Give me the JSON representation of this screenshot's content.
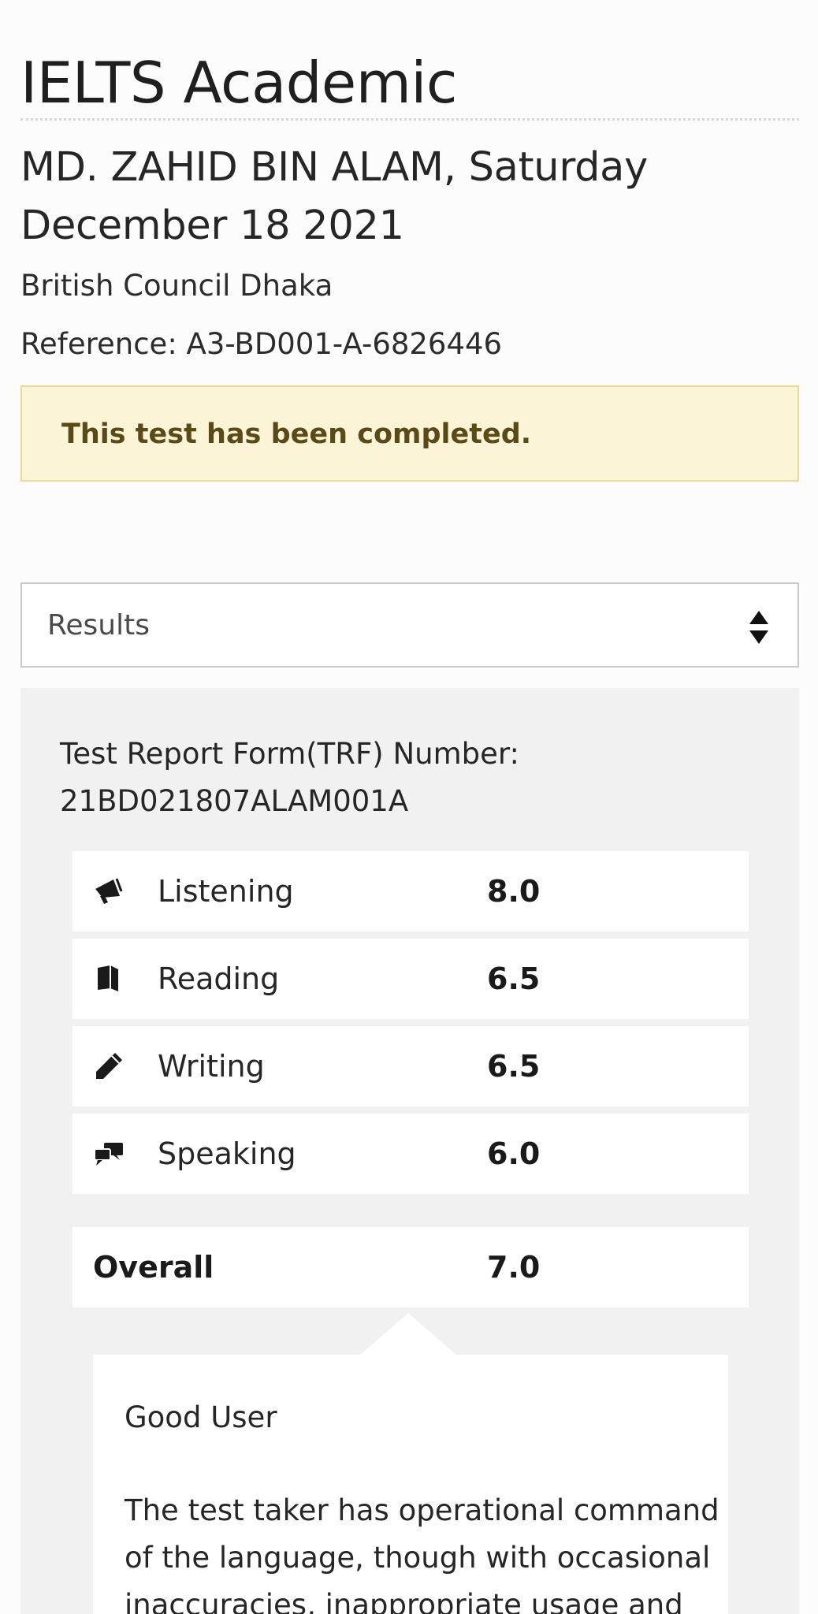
{
  "header": {
    "test_name": "IELTS Academic",
    "candidate_and_date": "MD. ZAHID BIN ALAM, Saturday December 18 2021",
    "test_centre": "British Council Dhaka",
    "reference": "Reference: A3-BD001-A-6826446"
  },
  "alert": {
    "message": "This test has been completed."
  },
  "section_select": {
    "selected": "Results",
    "icon": "sort-arrows-icon"
  },
  "results": {
    "trf_label": "Test Report Form(TRF) Number:",
    "trf_number": "21BD021807ALAM001A",
    "components": [
      {
        "label": "Listening",
        "score": "8.0",
        "icon": "megaphone-icon"
      },
      {
        "label": "Reading",
        "score": "6.5",
        "icon": "book-icon"
      },
      {
        "label": "Writing",
        "score": "6.5",
        "icon": "pencil-icon"
      },
      {
        "label": "Speaking",
        "score": "6.0",
        "icon": "speech-bubbles-icon"
      }
    ],
    "overall": {
      "label": "Overall",
      "score": "7.0"
    },
    "band": {
      "name": "Good User",
      "description": "The test taker has operational command of the language, though with occasional inaccuracies, inappropriate usage and"
    }
  }
}
